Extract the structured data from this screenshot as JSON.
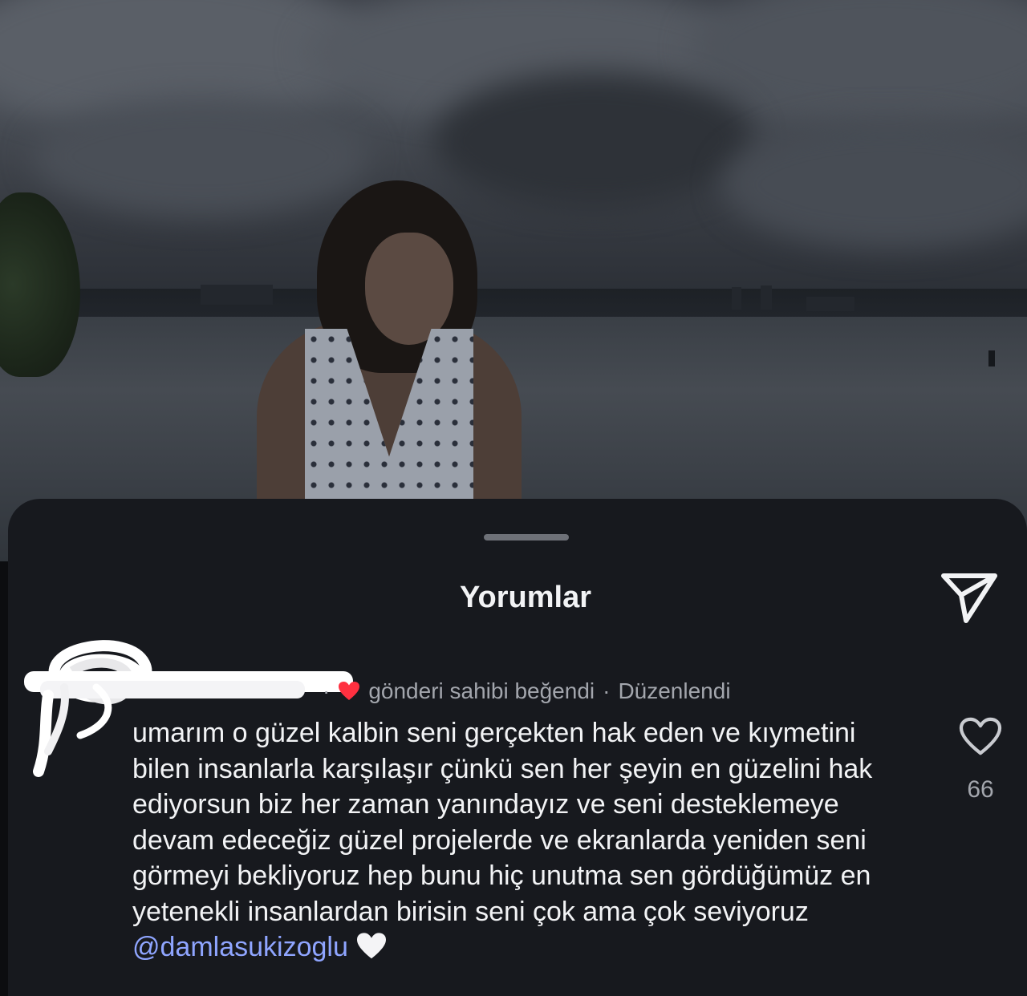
{
  "photo": {
    "description_icon": "photo-background"
  },
  "comments_sheet": {
    "title": "Yorumlar",
    "share_icon": "send-icon",
    "comment": {
      "username_redacted": true,
      "liked_by_author_icon": "red-heart-icon",
      "liked_by_author_text": "gönderi sahibi beğendi",
      "separator": "·",
      "edited_text": "Düzenlendi",
      "dot_before": "·",
      "body": "umarım o güzel kalbin seni gerçekten hak eden ve kıymetini bilen insanlarla karşılaşır çünkü sen her şeyin en güzelini hak ediyorsun biz her zaman yanındayız ve seni desteklemeye devam edeceğiz güzel projelerde ve ekranlarda yeniden seni görmeyi bekliyoruz hep bunu hiç unutma sen gördüğümüz en yetenekli insanlardan birisin seni çok ama çok seviyoruz",
      "mention": "@damlasukizoglu",
      "emoji": "white-heart-icon",
      "like_icon": "heart-outline-icon",
      "like_count": "66"
    },
    "colors": {
      "sheet_bg": "#17191e",
      "text_primary": "#f2f3f5",
      "text_secondary": "#a3a6ad",
      "mention": "#8fa5ff",
      "heart_red": "#ff3040"
    }
  }
}
